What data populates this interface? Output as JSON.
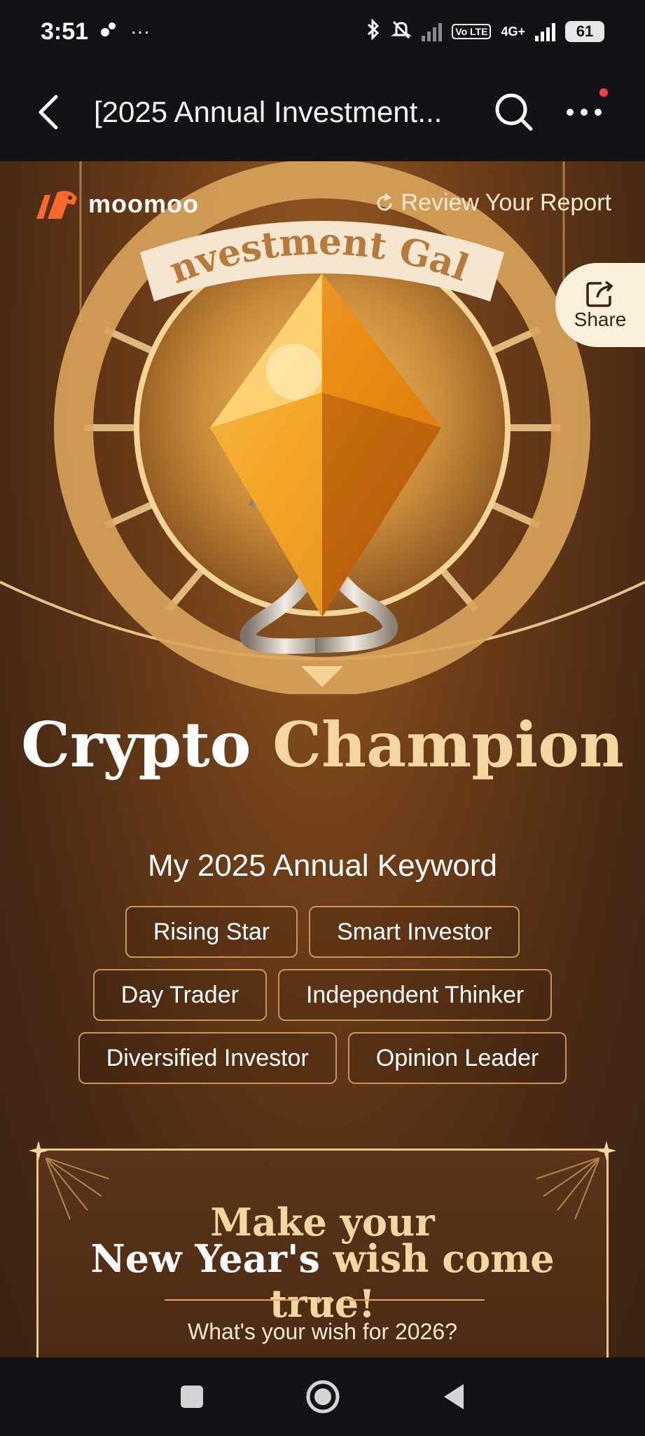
{
  "status_bar": {
    "time": "3:51",
    "more": "···",
    "network": "4G+",
    "volte": "Vo LTE",
    "battery": "61"
  },
  "nav": {
    "title": "[2025 Annual Investment...",
    "icons": [
      "back-arrow-icon",
      "search-icon",
      "more-icon"
    ]
  },
  "header": {
    "brand": "moomoo",
    "review_label": "Review Your Report",
    "share_label": "Share"
  },
  "medal": {
    "banner_text": "Investment Gala"
  },
  "hero": {
    "title_part1": "Crypto",
    "title_part2": "Champion"
  },
  "keywords": {
    "title": "My 2025 Annual Keyword",
    "rows": [
      [
        "Rising Star",
        "Smart Investor"
      ],
      [
        "Day Trader",
        "Independent Thinker"
      ],
      [
        "Diversified Investor",
        "Opinion Leader"
      ]
    ]
  },
  "wish": {
    "line1": "Make your",
    "line2_white": "New Year's",
    "line2_gold": "wish come true!",
    "question": "What's your wish for 2026?"
  },
  "colors": {
    "gold": "#f6d6a0",
    "chip_border": "#c9935a",
    "brand_orange": "#ff6a2b"
  }
}
